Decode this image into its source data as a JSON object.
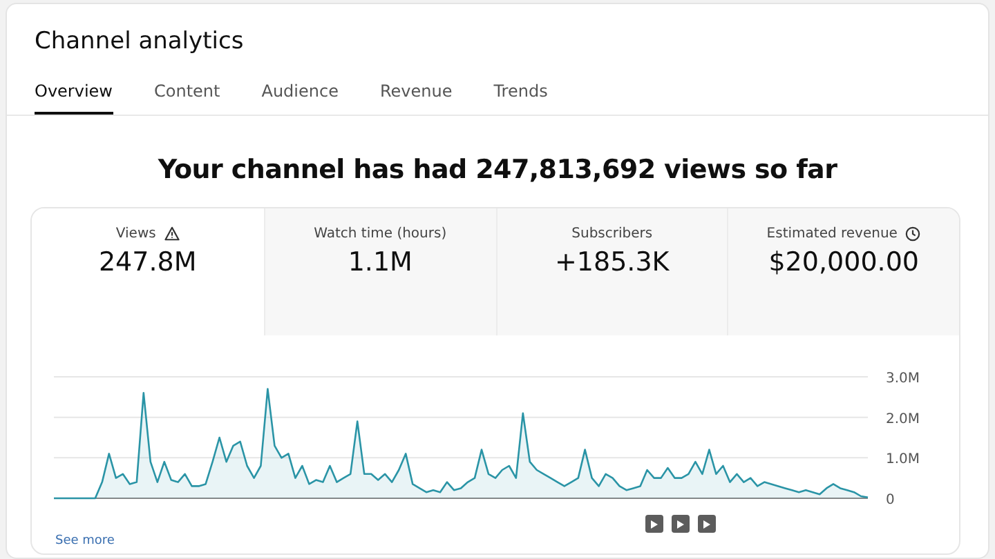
{
  "page": {
    "title": "Channel analytics"
  },
  "tabs": [
    {
      "label": "Overview",
      "selected": true
    },
    {
      "label": "Content",
      "selected": false
    },
    {
      "label": "Audience",
      "selected": false
    },
    {
      "label": "Revenue",
      "selected": false
    },
    {
      "label": "Trends",
      "selected": false
    }
  ],
  "headline": "Your channel has had 247,813,692 views so far",
  "metrics": [
    {
      "label": "Views",
      "value": "247.8M",
      "selected": true,
      "kind": "warning"
    },
    {
      "label": "Watch time (hours)",
      "value": "1.1M",
      "selected": false,
      "kind": "plain"
    },
    {
      "label": "Subscribers",
      "value": "+185.3K",
      "selected": false,
      "kind": "plain"
    },
    {
      "label": "Estimated revenue",
      "value": "$20,000.00",
      "selected": false,
      "kind": "clock"
    }
  ],
  "chart": {
    "chart_data": {
      "type": "area",
      "ylim": [
        0,
        3000000
      ],
      "yticks": [
        {
          "value": 0,
          "label": "0"
        },
        {
          "value": 1000000,
          "label": "1.0M"
        },
        {
          "value": 2000000,
          "label": "2.0M"
        },
        {
          "value": 3000000,
          "label": "3.0M"
        }
      ],
      "series": [
        {
          "color": "#2a94a6",
          "values": [
            0,
            0,
            0,
            0,
            0,
            0,
            0,
            400000,
            1100000,
            500000,
            600000,
            350000,
            400000,
            2600000,
            900000,
            400000,
            900000,
            450000,
            400000,
            600000,
            300000,
            300000,
            350000,
            900000,
            1500000,
            900000,
            1300000,
            1400000,
            800000,
            500000,
            800000,
            2700000,
            1300000,
            1000000,
            1100000,
            500000,
            800000,
            350000,
            450000,
            400000,
            800000,
            400000,
            500000,
            600000,
            1900000,
            600000,
            600000,
            450000,
            600000,
            400000,
            700000,
            1100000,
            350000,
            250000,
            150000,
            200000,
            150000,
            400000,
            200000,
            250000,
            400000,
            500000,
            1200000,
            600000,
            500000,
            700000,
            800000,
            500000,
            2100000,
            900000,
            700000,
            600000,
            500000,
            400000,
            300000,
            400000,
            500000,
            1200000,
            500000,
            300000,
            600000,
            500000,
            300000,
            200000,
            250000,
            300000,
            700000,
            500000,
            500000,
            750000,
            500000,
            500000,
            600000,
            900000,
            600000,
            1200000,
            600000,
            800000,
            400000,
            600000,
            400000,
            500000,
            300000,
            400000,
            350000,
            300000,
            250000,
            200000,
            150000,
            200000,
            150000,
            100000,
            250000,
            350000,
            250000,
            200000,
            150000,
            50000,
            20000
          ]
        }
      ]
    }
  },
  "see_more": "See more"
}
